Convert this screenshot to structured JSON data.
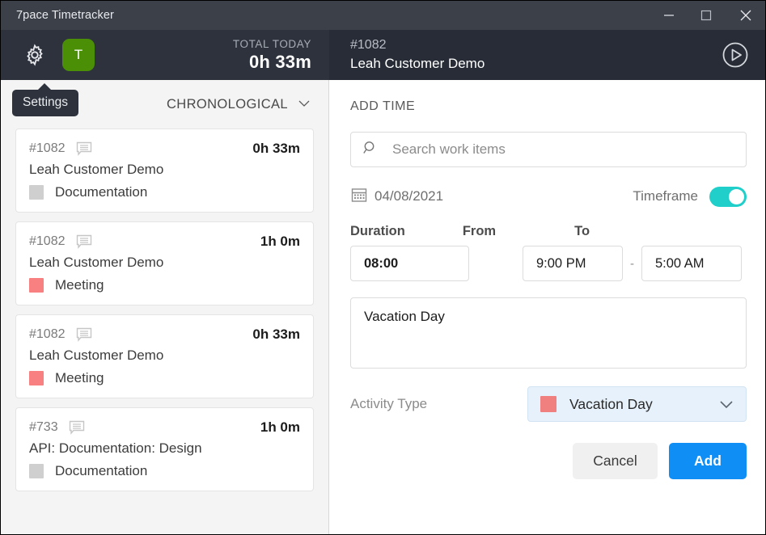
{
  "window": {
    "title": "7pace Timetracker",
    "controls": {
      "minimize": "minimize-icon",
      "maximize": "maximize-icon",
      "close": "close-icon"
    }
  },
  "topbar_left": {
    "settings_icon": "gear-icon",
    "avatar_initial": "T",
    "total_label": "TOTAL TODAY",
    "total_value": "0h 33m"
  },
  "topbar_right": {
    "ticket_id": "#1082",
    "ticket_title": "Leah Customer Demo",
    "play_icon": "play-circle-icon"
  },
  "tooltip": {
    "label": "Settings"
  },
  "left_panel": {
    "sort_label": "CHRONOLOGICAL",
    "sort_caret": "chevron-down-icon",
    "entries": [
      {
        "id": "#1082",
        "comment_icon": "comment-icon",
        "duration": "0h 33m",
        "title": "Leah Customer Demo",
        "activity": "Documentation",
        "activity_color": "#cfcfcf"
      },
      {
        "id": "#1082",
        "comment_icon": "comment-icon",
        "duration": "1h 0m",
        "title": "Leah Customer Demo",
        "activity": "Meeting",
        "activity_color": "#f98080"
      },
      {
        "id": "#1082",
        "comment_icon": "comment-icon",
        "duration": "0h 33m",
        "title": "Leah Customer Demo",
        "activity": "Meeting",
        "activity_color": "#f98080"
      },
      {
        "id": "#733",
        "comment_icon": "comment-icon",
        "duration": "1h 0m",
        "title": "API: Documentation: Design",
        "activity": "Documentation",
        "activity_color": "#cfcfcf"
      }
    ]
  },
  "right_panel": {
    "section_label": "ADD TIME",
    "search": {
      "icon": "search-icon",
      "placeholder": "Search work items",
      "value": ""
    },
    "date": {
      "icon": "calendar-icon",
      "value": "04/08/2021"
    },
    "timeframe": {
      "label": "Timeframe",
      "enabled": true,
      "on_color": "#20cfc9"
    },
    "duration": {
      "label": "Duration",
      "value": "08:00"
    },
    "from": {
      "label": "From",
      "value": "9:00 PM"
    },
    "to": {
      "label": "To",
      "value": "5:00 AM"
    },
    "separator": "-",
    "notes": {
      "value": "Vacation Day",
      "placeholder": ""
    },
    "activity_type": {
      "label": "Activity Type",
      "value": "Vacation Day",
      "color": "#f08080",
      "caret": "chevron-down-icon"
    },
    "buttons": {
      "cancel": "Cancel",
      "add": "Add",
      "add_color": "#0f8ff5"
    }
  }
}
